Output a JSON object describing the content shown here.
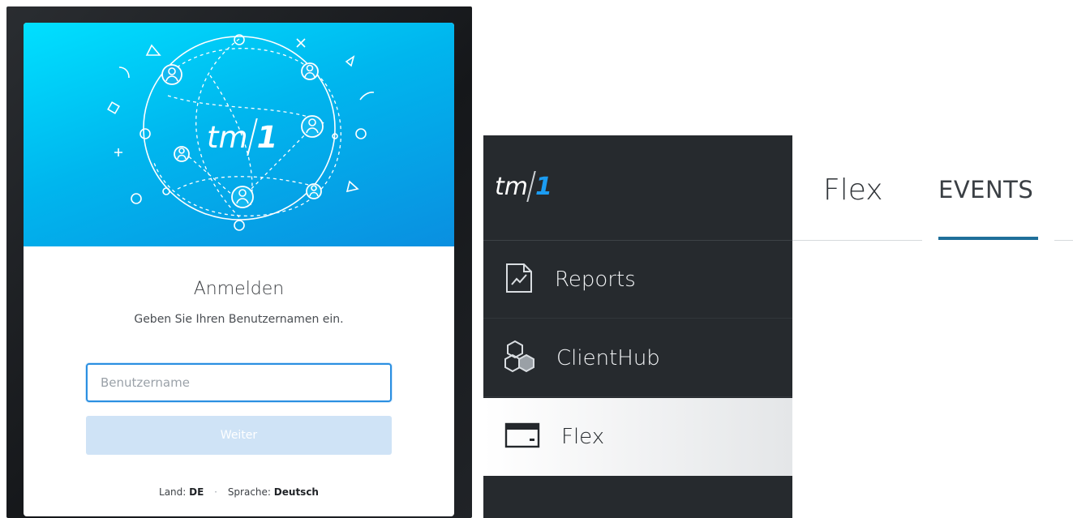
{
  "login": {
    "logo_tm": "tm",
    "logo_one": "1",
    "title": "Anmelden",
    "subtitle": "Geben Sie Ihren Benutzernamen ein.",
    "username_placeholder": "Benutzername",
    "username_value": "",
    "next_label": "Weiter",
    "footer": {
      "country_label": "Land:",
      "country_value": "DE",
      "separator": "·",
      "language_label": "Sprache:",
      "language_value": "Deutsch"
    }
  },
  "sidebar": {
    "logo_tm": "tm",
    "logo_one": "1",
    "items": [
      {
        "label": "Reports",
        "icon": "report-chart-icon",
        "active": false
      },
      {
        "label": "ClientHub",
        "icon": "cubes-icon",
        "active": false
      },
      {
        "label": "Flex",
        "icon": "credit-card-icon",
        "active": true
      }
    ]
  },
  "main": {
    "title": "Flex",
    "tabs": [
      {
        "label": "EVENTS",
        "active": true
      }
    ]
  },
  "colors": {
    "hero_gradient_start": "#00e0ff",
    "hero_gradient_end": "#0a8fe0",
    "sidebar_bg": "#262a2e",
    "logo_accent": "#1b9cf2",
    "input_focus": "#2a8fe1",
    "button_disabled": "#cfe3f6",
    "tab_underline": "#1f6f9a"
  }
}
